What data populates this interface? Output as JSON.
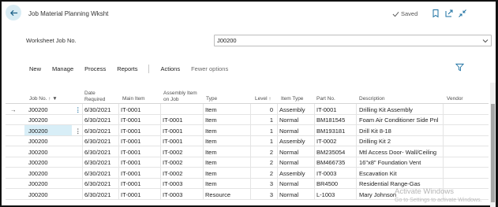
{
  "header": {
    "title": "Job Material Planning Wksht",
    "saved_label": "Saved"
  },
  "worksheet": {
    "label": "Worksheet Job No.",
    "value": "J00200"
  },
  "actions": {
    "new": "New",
    "manage": "Manage",
    "process": "Process",
    "reports": "Reports",
    "actions": "Actions",
    "fewer": "Fewer options"
  },
  "columns": {
    "job_no": "Job No.",
    "date_required_1": "Date",
    "date_required_2": "Required",
    "main_item": "Main Item",
    "assembly_1": "Assembly Item",
    "assembly_2": "on Job",
    "type": "Type",
    "level": "Level",
    "item_type": "Item Type",
    "part_no": "Part No.",
    "description": "Description",
    "vendor": "Vendor"
  },
  "rows": [
    {
      "job": "J00200",
      "date": "6/30/2021",
      "main": "IT-0001",
      "assembly": "",
      "type": "Item",
      "level": "0",
      "itemtype": "Assembly",
      "part": "IT-0001",
      "desc": "Drilling Kit Assembly"
    },
    {
      "job": "J00200",
      "date": "6/30/2021",
      "main": "IT-0001",
      "assembly": "IT-0001",
      "type": "Item",
      "level": "1",
      "itemtype": "Normal",
      "part": "BM181545",
      "desc": "Foam Air Conditioner Side Pnl"
    },
    {
      "job": "J00200",
      "date": "6/30/2021",
      "main": "IT-0001",
      "assembly": "IT-0001",
      "type": "Item",
      "level": "1",
      "itemtype": "Normal",
      "part": "BM193181",
      "desc": "Drill Kit 8-18"
    },
    {
      "job": "J00200",
      "date": "6/30/2021",
      "main": "IT-0001",
      "assembly": "IT-0001",
      "type": "Item",
      "level": "1",
      "itemtype": "Assembly",
      "part": "IT-0002",
      "desc": "Drilling Kit 2"
    },
    {
      "job": "J00200",
      "date": "6/30/2021",
      "main": "IT-0001",
      "assembly": "IT-0002",
      "type": "Item",
      "level": "2",
      "itemtype": "Normal",
      "part": "BM235054",
      "desc": "Mtl Access Door- Wall/Ceiling"
    },
    {
      "job": "J00200",
      "date": "6/30/2021",
      "main": "IT-0001",
      "assembly": "IT-0002",
      "type": "Item",
      "level": "2",
      "itemtype": "Normal",
      "part": "BM466735",
      "desc": "16\"x8\" Foundation Vent"
    },
    {
      "job": "J00200",
      "date": "6/30/2021",
      "main": "IT-0001",
      "assembly": "IT-0002",
      "type": "Item",
      "level": "2",
      "itemtype": "Assembly",
      "part": "IT-0003",
      "desc": "Escavation Kit"
    },
    {
      "job": "J00200",
      "date": "6/30/2021",
      "main": "IT-0001",
      "assembly": "IT-0003",
      "type": "Item",
      "level": "3",
      "itemtype": "Normal",
      "part": "BR4500",
      "desc": "Residential Range-Gas"
    },
    {
      "job": "J00200",
      "date": "6/30/2021",
      "main": "IT-0001",
      "assembly": "IT-0003",
      "type": "Resource",
      "level": "3",
      "itemtype": "Normal",
      "part": "L-1003",
      "desc": "Mary Johnson"
    }
  ],
  "watermark": {
    "line1": "Activate Windows",
    "line2": "Go to Settings to activate Windows."
  },
  "colors": {
    "accent": "#008489",
    "selected_row": "#d8eef7"
  }
}
